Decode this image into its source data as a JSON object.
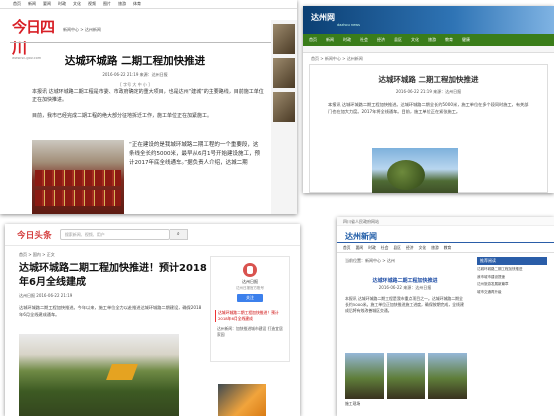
{
  "headline": "达城环城路 二期工程加快推进",
  "s1": {
    "topnav": [
      "首页",
      "新闻",
      "要闻",
      "时政",
      "文化",
      "视频",
      "图片",
      "旅游",
      "体育"
    ],
    "logo": "今日四川",
    "logo_url": "www.sc-gov.com",
    "crumb": "新闻中心 > 达州新闻",
    "meta": "2016-06-22 21:19  来源：达州日报",
    "font_size": "[ 字号 大 中 小 ]",
    "p1": "本报讯 达城环城路二期工程是市委、市政府确定的重大项目，也是达州“建城”的主要路线，目前施工单位正在加快推进。",
    "p2": "目前，我市已经完成二期工程的绝大部分征地拆迁工作，施工单位正在加紧施工。",
    "p3": "“正在建设的是我城环城路二期工程的一个重要段，这条线全长约5000米，最早从6月1号开始建设施工，预计2017年底全线通车。”据负责人介绍，达城二期"
  },
  "s2": {
    "logo": "达州网",
    "logo_sub": "dazhou news",
    "nav": [
      "首页",
      "新闻",
      "时政",
      "社会",
      "经济",
      "县区",
      "文化",
      "旅游",
      "教育",
      "健康"
    ],
    "crumb": "首页 > 新闻中心 > 达州新闻",
    "meta": "2016-06-22 21:19  来源：达州日报",
    "text": "本报讯 达城环城路二期工程加快推进。达城环城路二期全长约5000米，施工单位在多个段同时施工，有关部门也在加大力度。2017年将全线通车。目前，施工单位正在紧张施工。"
  },
  "s3": {
    "brand": "今日头条",
    "search_placeholder": "搜索新闻、视频、用户",
    "crumb": "首页 > 国内 > 正文",
    "title": "达城环城路二期工程加快推进！预计2018年6月全线建成",
    "meta": "达州日报  2016-06-22 21:19",
    "text": "达城环城路二期工程加快推进。今年以来，施工单位全力以赴推进达城环城路二期建设，确保2018年6月全线建成通车。",
    "author": "达州日报",
    "author_desc": "达州日报官方账号",
    "follow": "关注",
    "hot1": "达城环城路二期工程加快推进！预计2018年6月全线建成",
    "hot2": "达州新闻：加快推进城市建设 打造宜居家园"
  },
  "s4": {
    "top": "四川省人民政府网站",
    "logo": "达州新闻",
    "nav": [
      "首页",
      "要闻",
      "时政",
      "社会",
      "县区",
      "经济",
      "文化",
      "旅游",
      "教育"
    ],
    "crumb": "当前位置：新闻中心 > 达州",
    "title": "达城环城路二期工程加快推进",
    "meta": "2016-06-22  来源：达州日报",
    "text": "本报讯 达城环城路二期工程是我市重点项目之一。达城环城路二期全长约5000米。施工单位正加快推进施工进度，确保按期完成，全线建成后将有效改善城区交通。",
    "side_head": "推荐阅读",
    "side_items": [
      "达城环城路二期工程加快推进",
      "我市城市建设提速",
      "达州旅游发展新篇章",
      "城市交通再升级"
    ],
    "caption": "施工现场"
  }
}
